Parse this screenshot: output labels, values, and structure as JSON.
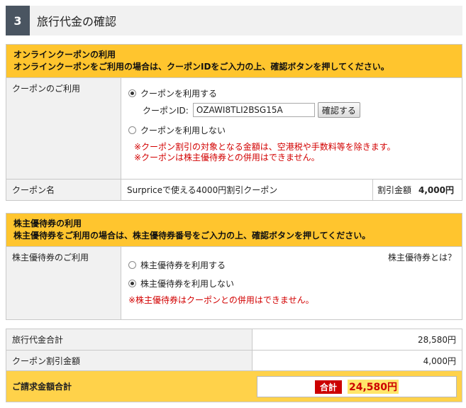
{
  "header": {
    "step_number": "3",
    "title": "旅行代金の確認"
  },
  "coupon": {
    "heading": "オンラインクーポンの利用",
    "instruction": "オンラインクーポンをご利用の場合は、クーポンIDをご入力の上、確認ボタンを押してください。",
    "usage_label": "クーポンのご利用",
    "option_use": "クーポンを利用する",
    "option_not_use": "クーポンを利用しない",
    "selected": "use",
    "id_label": "クーポンID:",
    "id_value": "OZAWI8TLI2BSG15A",
    "confirm_button": "確認する",
    "note1": "※クーポン割引の対象となる金額は、空港税や手数料等を除きます。",
    "note2": "※クーポンは株主優待券との併用はできません。",
    "name_label": "クーポン名",
    "name_value": "Surpriceで使える4000円割引クーポン",
    "discount_label": "割引金額",
    "discount_value": "4,000円"
  },
  "shareholder": {
    "heading": "株主優待券の利用",
    "instruction": "株主優待券をご利用の場合は、株主優待券番号をご入力の上、確認ボタンを押してください。",
    "usage_label": "株主優待券のご利用",
    "help_link": "株主優待券とは？",
    "option_use": "株主優待券を利用する",
    "option_not_use": "株主優待券を利用しない",
    "selected": "not_use",
    "note": "※株主優待券はクーポンとの併用はできません。"
  },
  "totals": {
    "travel_total_label": "旅行代金合計",
    "travel_total_value": "28,580円",
    "coupon_discount_label": "クーポン割引金額",
    "coupon_discount_value": "4,000円",
    "grand_total_label": "ご請求金額合計",
    "grand_total_badge": "合計",
    "grand_total_value": "24,580円"
  },
  "colors": {
    "accent": "#ffc52e",
    "step_badge": "#4a5561",
    "warning_red": "#d20000"
  }
}
